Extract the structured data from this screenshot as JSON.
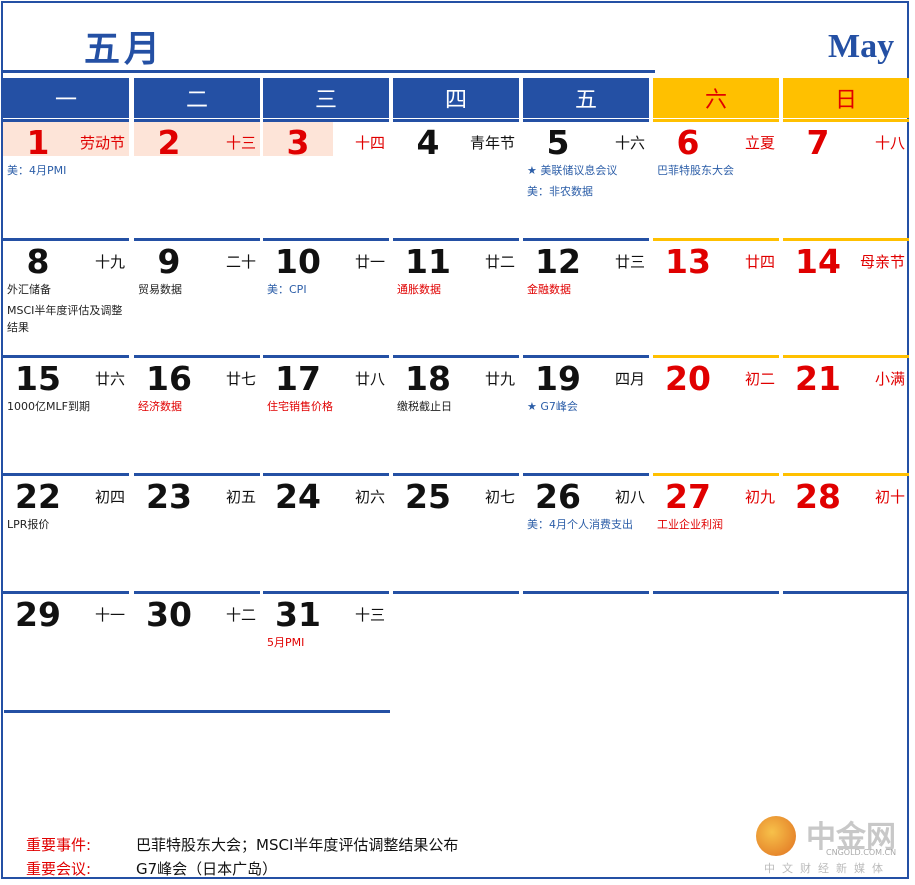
{
  "title_cn": "五月",
  "title_en": "May",
  "weekdays": [
    "一",
    "二",
    "三",
    "四",
    "五",
    "六",
    "日"
  ],
  "days": [
    {
      "num": "1",
      "lunar": "劳动节",
      "events": [
        {
          "text": "美：4月PMI",
          "color": "blue"
        }
      ]
    },
    {
      "num": "2",
      "lunar": "十三",
      "events": []
    },
    {
      "num": "3",
      "lunar": "十四",
      "events": []
    },
    {
      "num": "4",
      "lunar": "青年节",
      "events": []
    },
    {
      "num": "5",
      "lunar": "十六",
      "events": [
        {
          "text": "★ 美联储议息会议",
          "color": "blue"
        },
        {
          "text": "美：非农数据",
          "color": "blue"
        }
      ]
    },
    {
      "num": "6",
      "lunar": "立夏",
      "events": [
        {
          "text": "巴菲特股东大会",
          "color": "blue"
        }
      ]
    },
    {
      "num": "7",
      "lunar": "十八",
      "events": []
    },
    {
      "num": "8",
      "lunar": "十九",
      "events": [
        {
          "text": "外汇储备",
          "color": "black"
        },
        {
          "text": "MSCI半年度评估及调整结果",
          "color": "black"
        }
      ]
    },
    {
      "num": "9",
      "lunar": "二十",
      "events": [
        {
          "text": "贸易数据",
          "color": "black"
        }
      ]
    },
    {
      "num": "10",
      "lunar": "廿一",
      "events": [
        {
          "text": "美：CPI",
          "color": "blue"
        }
      ]
    },
    {
      "num": "11",
      "lunar": "廿二",
      "events": [
        {
          "text": "通胀数据",
          "color": "red"
        }
      ]
    },
    {
      "num": "12",
      "lunar": "廿三",
      "events": [
        {
          "text": "金融数据",
          "color": "red"
        }
      ]
    },
    {
      "num": "13",
      "lunar": "廿四",
      "events": []
    },
    {
      "num": "14",
      "lunar": "母亲节",
      "events": []
    },
    {
      "num": "15",
      "lunar": "廿六",
      "events": [
        {
          "text": "1000亿MLF到期",
          "color": "black"
        }
      ]
    },
    {
      "num": "16",
      "lunar": "廿七",
      "events": [
        {
          "text": "经济数据",
          "color": "red"
        }
      ]
    },
    {
      "num": "17",
      "lunar": "廿八",
      "events": [
        {
          "text": "住宅销售价格",
          "color": "red"
        }
      ]
    },
    {
      "num": "18",
      "lunar": "廿九",
      "events": [
        {
          "text": "缴税截止日",
          "color": "black"
        }
      ]
    },
    {
      "num": "19",
      "lunar": "四月",
      "events": [
        {
          "text": "★  G7峰会",
          "color": "blue"
        }
      ]
    },
    {
      "num": "20",
      "lunar": "初二",
      "events": []
    },
    {
      "num": "21",
      "lunar": "小满",
      "events": []
    },
    {
      "num": "22",
      "lunar": "初四",
      "events": [
        {
          "text": "LPR报价",
          "color": "black"
        }
      ]
    },
    {
      "num": "23",
      "lunar": "初五",
      "events": []
    },
    {
      "num": "24",
      "lunar": "初六",
      "events": []
    },
    {
      "num": "25",
      "lunar": "初七",
      "events": []
    },
    {
      "num": "26",
      "lunar": "初八",
      "events": [
        {
          "text": "美：4月个人消费支出",
          "color": "blue"
        }
      ]
    },
    {
      "num": "27",
      "lunar": "初九",
      "events": [
        {
          "text": "工业企业利润",
          "color": "red"
        }
      ]
    },
    {
      "num": "28",
      "lunar": "初十",
      "events": []
    },
    {
      "num": "29",
      "lunar": "十一",
      "events": []
    },
    {
      "num": "30",
      "lunar": "十二",
      "events": []
    },
    {
      "num": "31",
      "lunar": "十三",
      "events": [
        {
          "text": "5月PMI",
          "color": "red"
        }
      ]
    }
  ],
  "footer": {
    "events_label": "重要事件:",
    "events_value": "巴菲特股东大会；MSCI半年度评估调整结果公布",
    "meetings_label": "重要会议:",
    "meetings_value": "G7峰会（日本广岛）"
  },
  "logo": {
    "name": "中金网",
    "url": "CNGOLD.COM.CN",
    "sub": "中文财经新媒体"
  },
  "colors": {
    "blue": "#2450a4",
    "yellow": "#ffc000",
    "red": "#e00000",
    "highlight": "#fde4d8"
  }
}
